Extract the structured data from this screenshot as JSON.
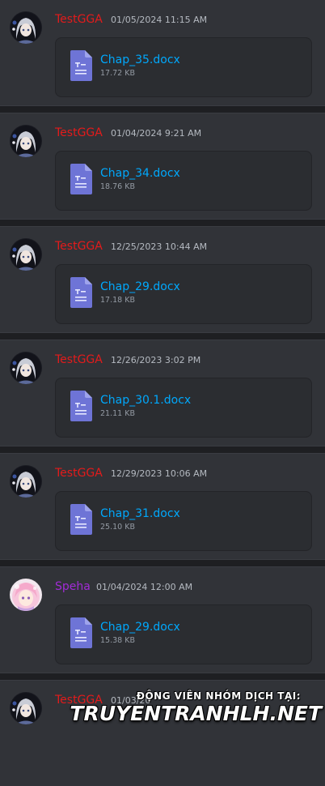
{
  "messages": [
    {
      "author": "TestGGA",
      "author_color": "#e31b1b",
      "avatar": "silver-hair-avatar",
      "timestamp": "01/05/2024 11:15 AM",
      "file": {
        "name": "Chap_35.docx",
        "size": "17.72 KB"
      }
    },
    {
      "author": "TestGGA",
      "author_color": "#e31b1b",
      "avatar": "silver-hair-avatar",
      "timestamp": "01/04/2024 9:21 AM",
      "file": {
        "name": "Chap_34.docx",
        "size": "18.76 KB"
      }
    },
    {
      "author": "TestGGA",
      "author_color": "#e31b1b",
      "avatar": "silver-hair-avatar",
      "timestamp": "12/25/2023 10:44 AM",
      "file": {
        "name": "Chap_29.docx",
        "size": "17.18 KB"
      }
    },
    {
      "author": "TestGGA",
      "author_color": "#e31b1b",
      "avatar": "silver-hair-avatar",
      "timestamp": "12/26/2023 3:02 PM",
      "file": {
        "name": "Chap_30.1.docx",
        "size": "21.11 KB"
      }
    },
    {
      "author": "TestGGA",
      "author_color": "#e31b1b",
      "avatar": "silver-hair-avatar",
      "timestamp": "12/29/2023 10:06 AM",
      "file": {
        "name": "Chap_31.docx",
        "size": "25.10 KB"
      }
    },
    {
      "author": "Speha",
      "author_color": "#a12bd6",
      "avatar": "pink-hair-avatar",
      "timestamp": "01/04/2024 12:00 AM",
      "file": {
        "name": "Chap_29.docx",
        "size": "15.38 KB"
      }
    },
    {
      "author": "TestGGA",
      "author_color": "#e31b1b",
      "avatar": "silver-hair-avatar",
      "timestamp": "01/03/20",
      "file": null
    }
  ],
  "watermark": {
    "line1": "ĐỘNG VIÊN NHÓM DỊCH TẠI:",
    "line2": "TRUYENTRANHLH.NET"
  },
  "colors": {
    "link": "#00a8fc",
    "background": "#313338",
    "separator": "#1e1f22",
    "file_icon": "#6e74d6"
  }
}
